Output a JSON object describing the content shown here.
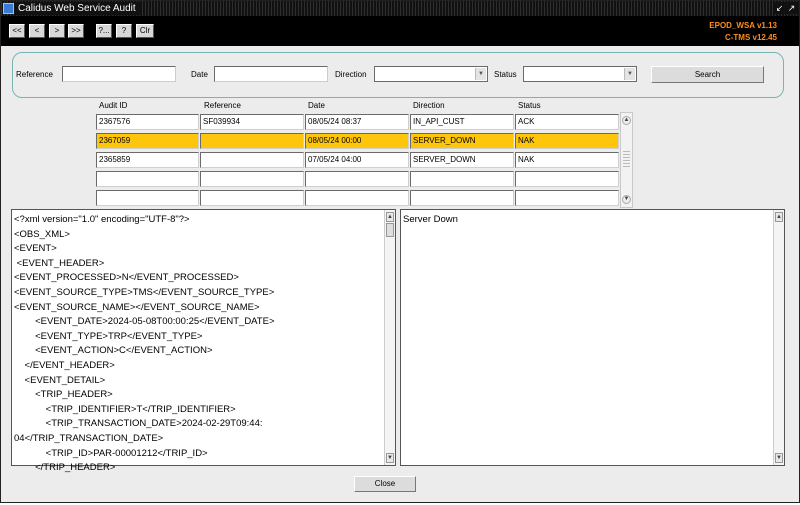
{
  "window": {
    "title": "Calidus Web Service Audit"
  },
  "toolbar": {
    "buttons": [
      "<<",
      "<",
      ">",
      ">>",
      "?...",
      "?",
      "Clr"
    ],
    "version_line1": "EPOD_WSA v1.13",
    "version_line2": "C-TMS v12.45"
  },
  "filters": {
    "reference_label": "Reference",
    "reference_value": "",
    "date_label": "Date",
    "date_value": "",
    "direction_label": "Direction",
    "direction_value": "",
    "status_label": "Status",
    "status_value": "",
    "search_label": "Search"
  },
  "grid": {
    "columns": [
      "Audit ID",
      "Reference",
      "Date",
      "Direction",
      "Status"
    ],
    "rows": [
      [
        "2367576",
        "SF039934",
        "08/05/24 08:37",
        "IN_API_CUST",
        "ACK"
      ],
      [
        "2367059",
        "",
        "08/05/24 00:00",
        "SERVER_DOWN",
        "NAK"
      ],
      [
        "2365859",
        "",
        "07/05/24 04:00",
        "SERVER_DOWN",
        "NAK"
      ],
      [
        "",
        "",
        "",
        "",
        ""
      ],
      [
        "",
        "",
        "",
        "",
        ""
      ]
    ],
    "selected_row": 1
  },
  "xml_pane": {
    "lines": [
      "<?xml version=\"1.0\" encoding=\"UTF-8\"?>",
      "<OBS_XML>",
      "<EVENT>",
      " <EVENT_HEADER>",
      "<EVENT_PROCESSED>N</EVENT_PROCESSED>",
      "<EVENT_SOURCE_TYPE>TMS</EVENT_SOURCE_TYPE>",
      "<EVENT_SOURCE_NAME></EVENT_SOURCE_NAME>",
      "        <EVENT_DATE>2024-05-08T00:00:25</EVENT_DATE>",
      "        <EVENT_TYPE>TRP</EVENT_TYPE>",
      "        <EVENT_ACTION>C</EVENT_ACTION>",
      "    </EVENT_HEADER>",
      "    <EVENT_DETAIL>",
      "        <TRIP_HEADER>",
      "            <TRIP_IDENTIFIER>T</TRIP_IDENTIFIER>",
      "            <TRIP_TRANSACTION_DATE>2024-02-29T09:44:",
      "04</TRIP_TRANSACTION_DATE>",
      "            <TRIP_ID>PAR-00001212</TRIP_ID>",
      "        </TRIP_HEADER>"
    ]
  },
  "message_pane": {
    "text": "Server Down"
  },
  "footer": {
    "close_label": "Close"
  },
  "colors": {
    "selected_row": "#fec60b",
    "version_text": "#ff8c1a",
    "panel_border": "#78b4b4"
  }
}
